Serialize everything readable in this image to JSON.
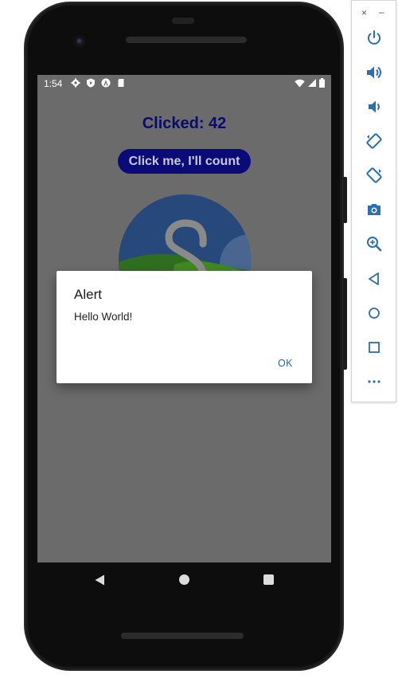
{
  "status_bar": {
    "time": "1:54"
  },
  "app": {
    "clicked_label": "Clicked: 42",
    "count_button_label": "Click me, I'll count"
  },
  "dialog": {
    "title": "Alert",
    "message": "Hello World!",
    "ok_label": "OK"
  },
  "toolbar": {
    "close_label": "×",
    "minimize_label": "–",
    "buttons": [
      {
        "icon": "power-icon"
      },
      {
        "icon": "volume-up-icon"
      },
      {
        "icon": "volume-down-icon"
      },
      {
        "icon": "rotate-left-icon"
      },
      {
        "icon": "rotate-right-icon"
      },
      {
        "icon": "camera-icon"
      },
      {
        "icon": "zoom-icon"
      },
      {
        "icon": "back-icon"
      },
      {
        "icon": "home-icon"
      },
      {
        "icon": "overview-icon"
      },
      {
        "icon": "more-icon"
      }
    ]
  },
  "colors": {
    "screen_dim": "#6b6b6b",
    "title_text": "#0b0b6b",
    "button_bg": "#0a0a78",
    "dialog_ok": "#1e6aa8",
    "toolbar_icon": "#2a6fb0"
  }
}
